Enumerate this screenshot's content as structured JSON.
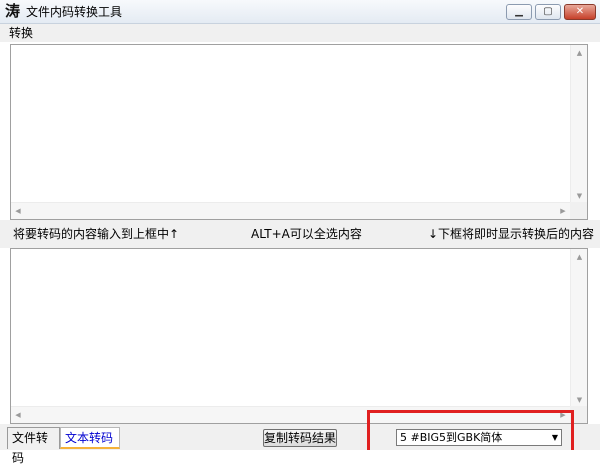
{
  "window": {
    "title": "文件内码转换工具",
    "app_icon_glyph": "涛",
    "icons": [
      "app-icon",
      "minimize-icon",
      "maximize-icon",
      "close-icon"
    ]
  },
  "menu": {
    "items": [
      {
        "label": "转换"
      }
    ]
  },
  "hints": {
    "left": "将要转码的内容输入到上框中↑",
    "middle": "ALT+A可以全选内容",
    "right": "↓下框将即时显示转换后的内容"
  },
  "input_area": {
    "value": ""
  },
  "output_area": {
    "value": ""
  },
  "tabs": [
    {
      "label": "文件转码",
      "active": false
    },
    {
      "label": "文本转码",
      "active": true
    }
  ],
  "copy_button": {
    "label": "复制转码结果"
  },
  "conversion_select": {
    "selected": "5 #BIG5到GBK简体"
  },
  "colors": {
    "highlight_border": "#e02020",
    "active_tab_text": "#0000d0",
    "active_tab_accent": "#f5b23a",
    "window_bg": "#f0f0f0"
  }
}
